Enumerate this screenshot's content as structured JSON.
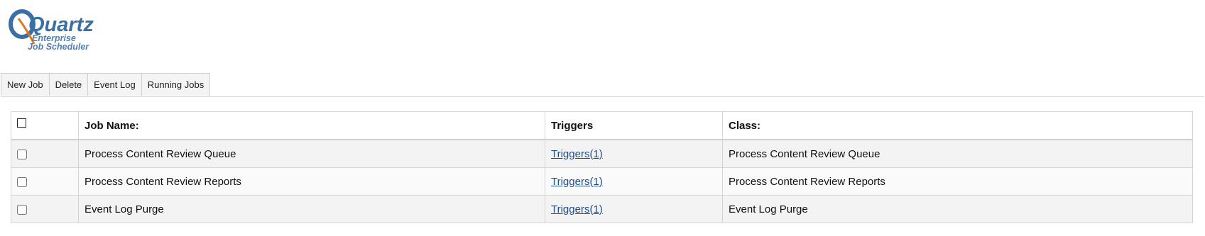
{
  "logo": {
    "word": "Quartz",
    "line1": "Enterprise",
    "line2": "Job Scheduler"
  },
  "toolbar": {
    "buttons": [
      "New Job",
      "Delete",
      "Event Log",
      "Running Jobs"
    ]
  },
  "table": {
    "headers": {
      "name": "Job Name:",
      "triggers": "Triggers",
      "class": "Class:"
    },
    "rows": [
      {
        "name": "Process Content Review Queue",
        "triggers": "Triggers(1)",
        "class": "Process Content Review Queue",
        "checked": false
      },
      {
        "name": "Process Content Review Reports",
        "triggers": "Triggers(1)",
        "class": "Process Content Review Reports",
        "checked": false
      },
      {
        "name": "Event Log Purge",
        "triggers": "Triggers(1)",
        "class": "Event Log Purge",
        "checked": false
      }
    ]
  },
  "colors": {
    "logo_blue": "#3a6fa5",
    "logo_orange": "#e07a1f",
    "link": "#1f4e8c"
  }
}
